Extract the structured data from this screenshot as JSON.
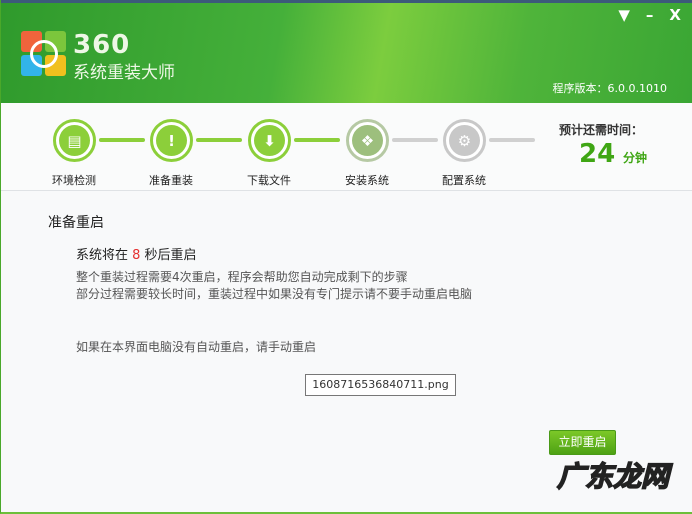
{
  "header": {
    "brand_number": "360",
    "brand_name": "系统重装大师",
    "version": "程序版本：6.0.0.1010",
    "controls": {
      "menu": "▼",
      "minimize": "–",
      "close": "X"
    }
  },
  "steps": [
    {
      "label": "环境检测",
      "status": "done",
      "icon": "computer-icon",
      "glyph": "▤"
    },
    {
      "label": "准备重装",
      "status": "done",
      "icon": "document-alert-icon",
      "glyph": "!"
    },
    {
      "label": "下载文件",
      "status": "done",
      "icon": "download-icon",
      "glyph": "⬇"
    },
    {
      "label": "安装系统",
      "status": "current",
      "icon": "install-box-icon",
      "glyph": "❖"
    },
    {
      "label": "配置系统",
      "status": "pending",
      "icon": "windows-gear-icon",
      "glyph": "⚙"
    }
  ],
  "eta": {
    "label": "预计还需时间：",
    "value": "24",
    "unit": "分钟"
  },
  "main": {
    "title": "准备重启",
    "countdown_prefix": "系统将在 ",
    "countdown_seconds": "8",
    "countdown_suffix": " 秒后重启",
    "desc_line1": "整个重装过程需要4次重启，程序会帮助您自动完成剩下的步骤",
    "desc_line2": "部分过程需要较长时间，重装过程中如果没有专门提示请不要手动重启电脑",
    "manual": "如果在本界面电脑没有自动重启，请手动重启",
    "file": "1608716536840711.png",
    "restart_button": "立即重启"
  },
  "watermark": "广东龙网",
  "colors": {
    "accent": "#3fa614",
    "step_done": "#8ccf3a",
    "countdown": "#e53030"
  }
}
